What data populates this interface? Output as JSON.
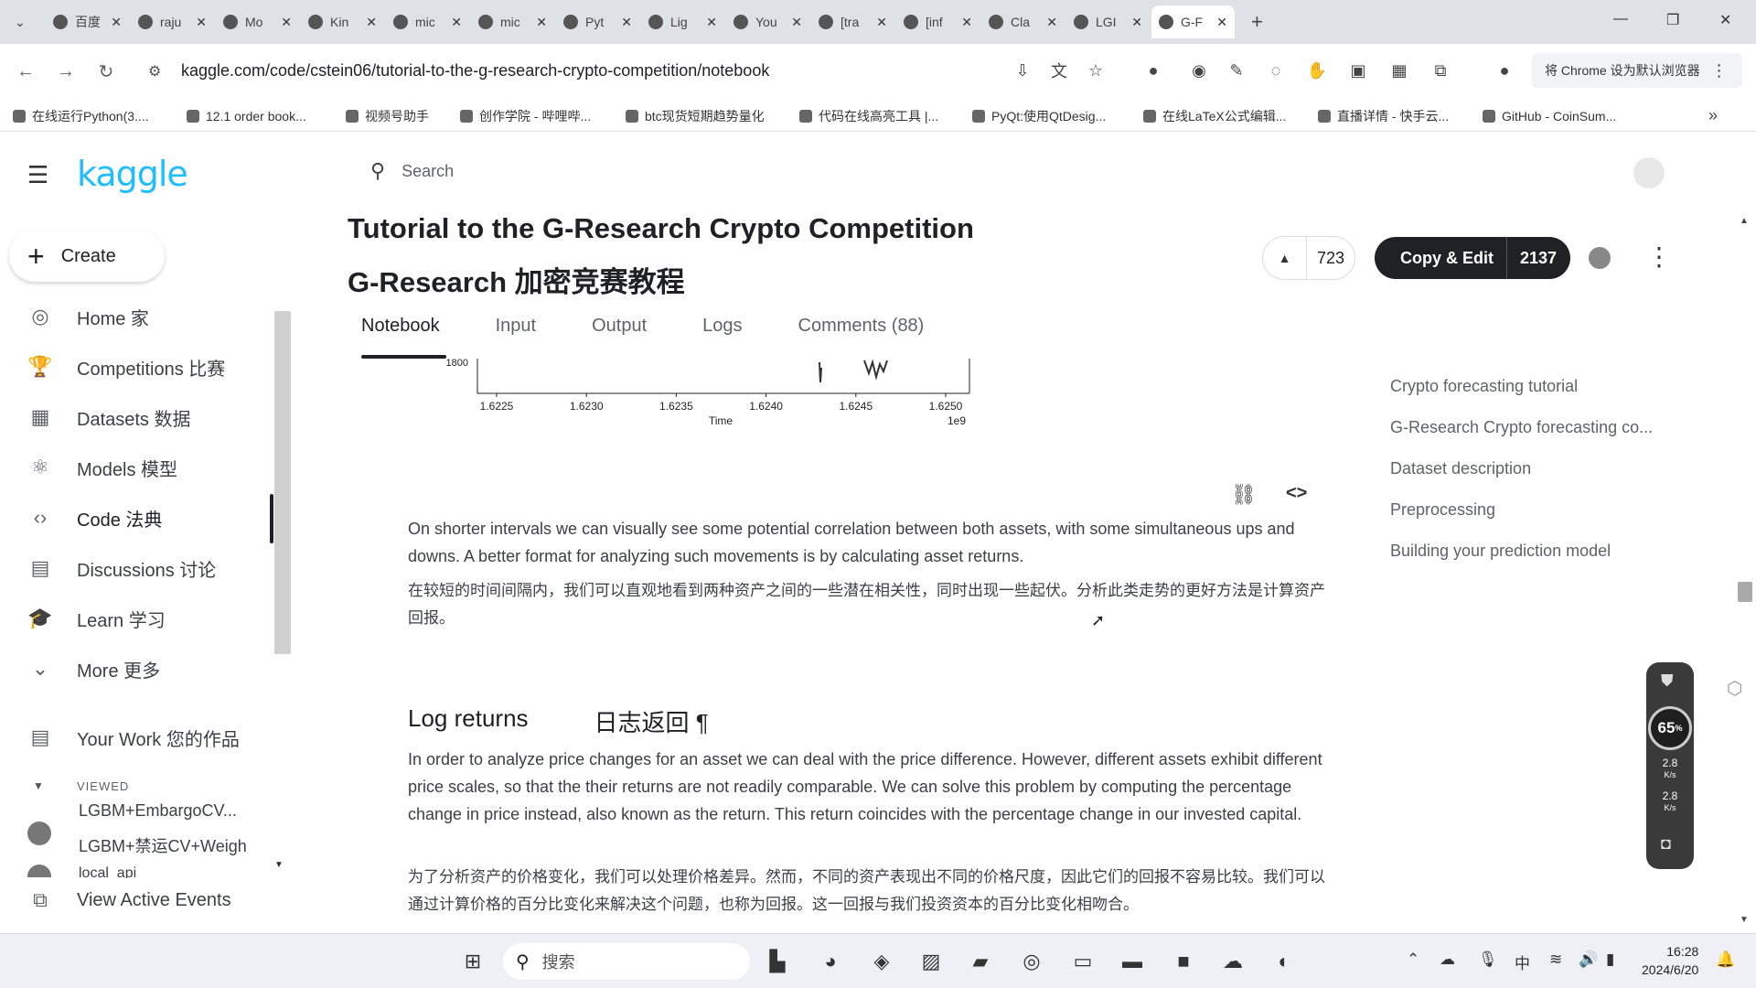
{
  "browser": {
    "tabs": [
      {
        "icon": "baidu-icon",
        "label": "百度"
      },
      {
        "icon": "github-icon",
        "label": "raju"
      },
      {
        "icon": "github-icon",
        "label": "Mo"
      },
      {
        "icon": "k-icon",
        "label": "Kin"
      },
      {
        "icon": "github-icon",
        "label": "mic"
      },
      {
        "icon": "github-icon",
        "label": "mic"
      },
      {
        "icon": "python-icon",
        "label": "Pyt"
      },
      {
        "icon": "github-icon",
        "label": "Lig"
      },
      {
        "icon": "kaggle-icon",
        "label": "You"
      },
      {
        "icon": "kaggle-icon",
        "label": "[tra"
      },
      {
        "icon": "kaggle-icon",
        "label": "[inf"
      },
      {
        "icon": "claude-icon",
        "label": "Cla"
      },
      {
        "icon": "kaggle-icon",
        "label": "LGI"
      },
      {
        "icon": "kaggle-icon",
        "label": "G-F"
      }
    ],
    "url": "kaggle.com/code/cstein06/tutorial-to-the-g-research-crypto-competition/notebook",
    "default_browser_btn": "将 Chrome 设为默认浏览器",
    "bookmarks": [
      "在线运行Python(3....",
      "12.1 order book...",
      "视频号助手",
      "创作学院 - 哔哩哔...",
      "btc现货短期趋势量化",
      "代码在线高亮工具 |...",
      "PyQt:使用QtDesig...",
      "在线LaTeX公式编辑...",
      "直播详情 - 快手云...",
      "GitHub - CoinSum..."
    ]
  },
  "kaggle": {
    "logo": "kaggle",
    "search_placeholder": "Search",
    "create_label": "Create",
    "nav": [
      {
        "label": "Home 家",
        "icon": "compass-icon"
      },
      {
        "label": "Competitions 比赛",
        "icon": "trophy-icon"
      },
      {
        "label": "Datasets 数据",
        "icon": "table-icon"
      },
      {
        "label": "Models 模型",
        "icon": "models-icon"
      },
      {
        "label": "Code 法典",
        "icon": "code-icon"
      },
      {
        "label": "Discussions 讨论",
        "icon": "discussion-icon"
      },
      {
        "label": "Learn 学习",
        "icon": "learn-icon"
      },
      {
        "label": "More 更多",
        "icon": "chevron-down-icon"
      }
    ],
    "your_work": "Your Work 您的作品",
    "viewed_label": "VIEWED",
    "viewed_items": [
      "LGBM+EmbargoCV...",
      "LGBM+禁运CV+Weigh",
      "local_api"
    ],
    "view_active_events": "View Active Events"
  },
  "notebook": {
    "title_en": "Tutorial to the G-Research Crypto Competition",
    "title_zh": "G-Research 加密竞赛教程",
    "votes": "723",
    "copy_edit_label": "Copy & Edit",
    "copy_edit_count": "2137",
    "tabs": [
      "Notebook",
      "Input",
      "Output",
      "Logs",
      "Comments (88)"
    ],
    "para1_en": "On shorter intervals we can visually see some potential correlation between both assets, with some simultaneous ups and downs. A better format for analyzing such movements is by calculating asset returns.",
    "para1_zh": "在较短的时间间隔内，我们可以直观地看到两种资产之间的一些潜在相关性，同时出现一些起伏。分析此类走势的更好方法是计算资产回报。",
    "heading_en": "Log returns",
    "heading_zh": "日志返回 ¶",
    "para2_en": "In order to analyze price changes for an asset we can deal with the price difference. However, different assets exhibit different price scales, so that the their returns are not readily comparable. We can solve this problem by computing the percentage change in price instead, also known as the return. This return coincides with the percentage change in our invested capital.",
    "para2_zh": "为了分析资产的价格变化，我们可以处理价格差异。然而，不同的资产表现出不同的价格尺度，因此它们的回报不容易比较。我们可以通过计算价格的百分比变化来解决这个问题，也称为回报。这一回报与我们投资资本的百分比变化相吻合。",
    "toc": [
      "Crypto forecasting tutorial",
      "G-Research Crypto forecasting co...",
      "Dataset description",
      "Preprocessing",
      "Building your prediction model"
    ]
  },
  "chart_data": {
    "type": "line",
    "x_ticks": [
      "1.6225",
      "1.6230",
      "1.6235",
      "1.6240",
      "1.6245",
      "1.6250"
    ],
    "xlabel": "Time",
    "x_exponent": "1e9",
    "y_tick_visible": "1800"
  },
  "widget": {
    "percent": "65",
    "percent_unit": "%",
    "up_speed": "2.8",
    "down_speed": "2.8",
    "speed_unit": "K/s"
  },
  "taskbar": {
    "search_placeholder": "搜索",
    "ime": "中",
    "time": "16:28",
    "date": "2024/6/20"
  }
}
